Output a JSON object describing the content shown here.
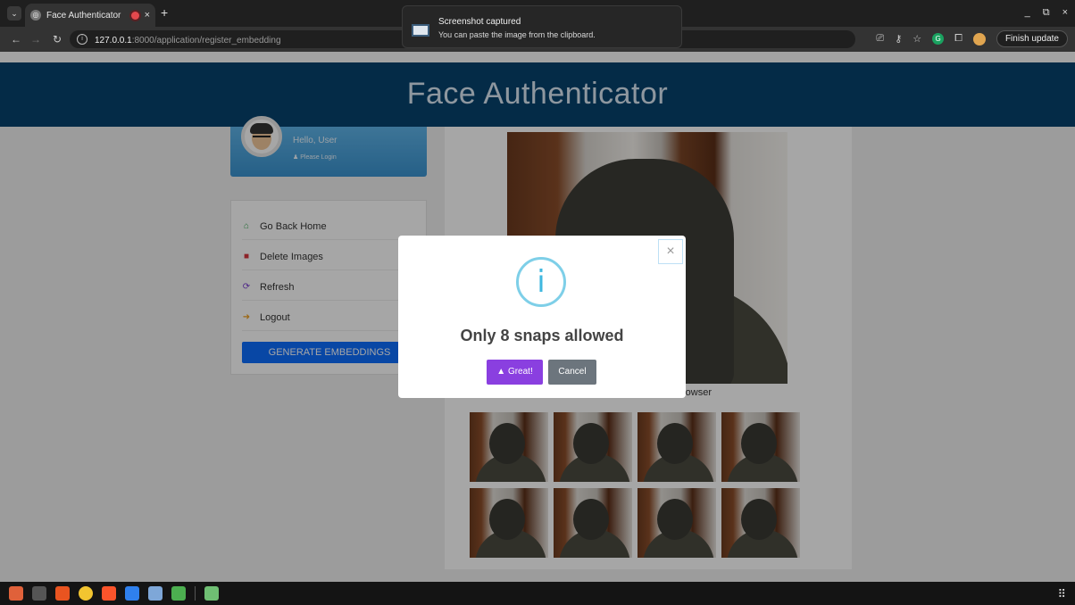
{
  "browser": {
    "tab_title": "Face Authenticator",
    "tab_close": "×",
    "new_tab": "+",
    "url_host": "127.0.0.1",
    "url_path": ":8000/application/register_embedding",
    "finish_update": "Finish update",
    "window_min": "_",
    "window_close": "×"
  },
  "notification": {
    "title": "Screenshot captured",
    "body": "You can paste the image from the clipboard."
  },
  "header": {
    "title": "Face Authenticator"
  },
  "sidebar": {
    "greeting": "Hello, User",
    "login_link": "Please Login",
    "menu": [
      {
        "label": "Go Back Home",
        "icon": "home-icon",
        "color": "#3aa655"
      },
      {
        "label": "Delete Images",
        "icon": "trash-icon",
        "color": "#d9363e"
      },
      {
        "label": "Refresh",
        "icon": "refresh-icon",
        "color": "#7b3fd1"
      },
      {
        "label": "Logout",
        "icon": "logout-icon",
        "color": "#f0a020"
      }
    ],
    "generate_button": "GENERATE EMBEDDINGS"
  },
  "camera": {
    "partial_text": "rowser"
  },
  "dialog": {
    "title": "Only 8 snaps allowed",
    "confirm": "Great!",
    "cancel": "Cancel",
    "icon": "info-icon"
  },
  "colors": {
    "header_bg": "#07426e",
    "primary": "#0d6efd",
    "confirm_bg": "#8a3fe0",
    "cancel_bg": "#6c757d"
  }
}
